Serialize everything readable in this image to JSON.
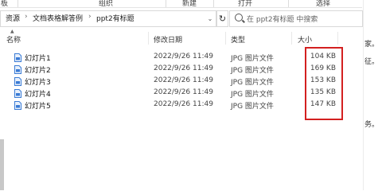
{
  "ribbon": {
    "groups": [
      "板",
      "组织",
      "新建",
      "打开",
      "选择"
    ]
  },
  "addressbar": {
    "crumbs": [
      "资源",
      "文档表格解答例",
      "ppt2有标题"
    ]
  },
  "search": {
    "placeholder": "在 ppt2有标题 中搜索"
  },
  "columns": {
    "name": "名称",
    "date": "修改日期",
    "type": "类型",
    "size": "大小"
  },
  "files": [
    {
      "name": "幻灯片1",
      "date": "2022/9/26 11:49",
      "type": "JPG 图片文件",
      "size": "104 KB"
    },
    {
      "name": "幻灯片2",
      "date": "2022/9/26 11:49",
      "type": "JPG 图片文件",
      "size": "169 KB"
    },
    {
      "name": "幻灯片3",
      "date": "2022/9/26 11:49",
      "type": "JPG 图片文件",
      "size": "153 KB"
    },
    {
      "name": "幻灯片4",
      "date": "2022/9/26 11:49",
      "type": "JPG 图片文件",
      "size": "135 KB"
    },
    {
      "name": "幻灯片5",
      "date": "2022/9/26 11:49",
      "type": "JPG 图片文件",
      "size": "147 KB"
    }
  ],
  "background_doc": {
    "fragments": [
      "家。",
      "征。",
      "务。"
    ]
  },
  "colors": {
    "highlight": "#d32020",
    "file_icon": "#3a7bd5"
  }
}
